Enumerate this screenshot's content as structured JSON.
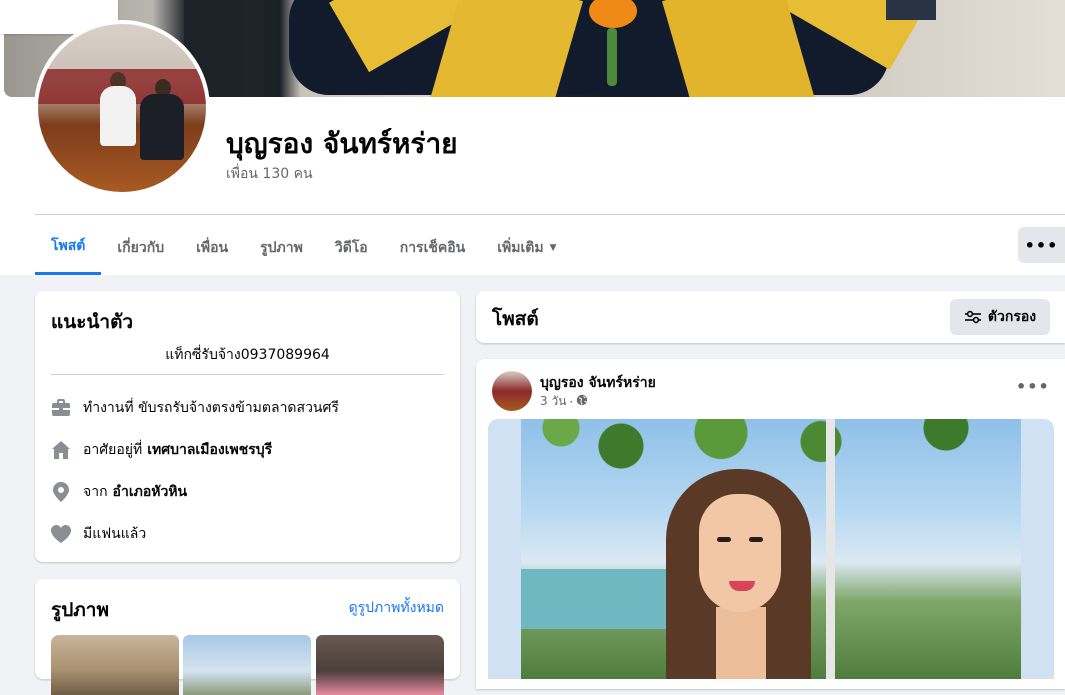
{
  "profile": {
    "name": "บุญรอง จันทร์หร่าย",
    "friends_count": "เพื่อน 130 คน"
  },
  "tabs": [
    {
      "label": "โพสต์"
    },
    {
      "label": "เกี่ยวกับ"
    },
    {
      "label": "เพื่อน"
    },
    {
      "label": "รูปภาพ"
    },
    {
      "label": "วิดีโอ"
    },
    {
      "label": "การเช็คอิน"
    },
    {
      "label": "เพิ่มเติม"
    }
  ],
  "more_button": {
    "label": "•••"
  },
  "intro": {
    "title": "แนะนำตัว",
    "bio": "แท็กซี่รับจ้าง0937089964",
    "work": {
      "text": "ทำงานที่ ขับรถรับจ้างตรงข้ามตลาดสวนศรี",
      "icon": "briefcase-icon"
    },
    "lives": {
      "prefix": "อาศัยอยู่ที่",
      "place": "เทศบาลเมืองเพชรบุรี",
      "icon": "home-icon"
    },
    "from": {
      "prefix": "จาก",
      "place": "อำเภอหัวหิน",
      "icon": "location-pin-icon"
    },
    "relationship": {
      "text": "มีแฟนแล้ว",
      "icon": "heart-icon"
    }
  },
  "photos": {
    "title": "รูปภาพ",
    "see_all": "ดูรูปภาพทั้งหมด"
  },
  "posts": {
    "title": "โพสต์",
    "filter_label": "ตัวกรอง"
  },
  "post": {
    "author": "บุญรอง จันทร์หร่าย",
    "time": "3 วัน",
    "dot": "·",
    "audience_icon": "globe-icon",
    "more_label": "•••"
  },
  "colors": {
    "accent": "#1877f2",
    "secondary_text": "#65676b",
    "page_bg": "#f0f2f5"
  }
}
